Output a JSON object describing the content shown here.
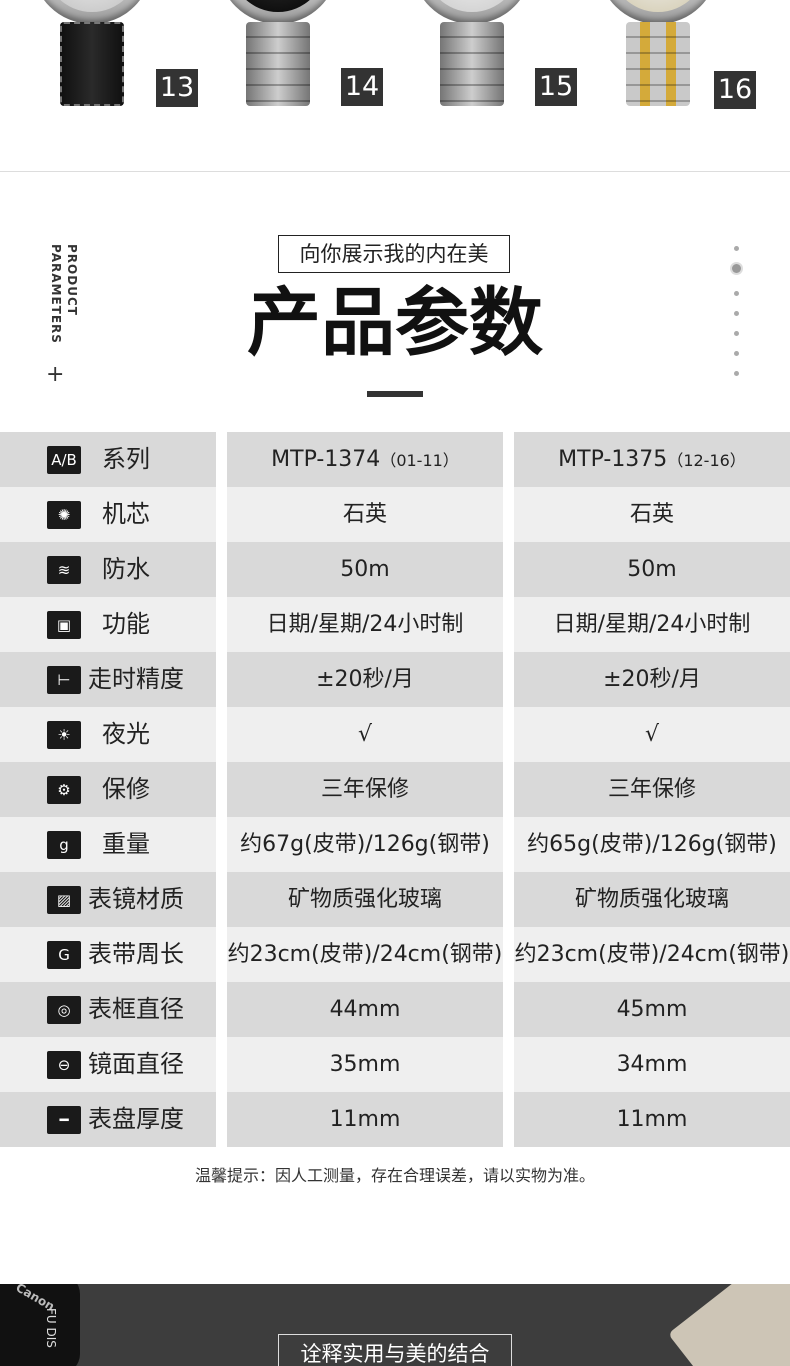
{
  "watches": [
    {
      "number": "13",
      "strap": "leather"
    },
    {
      "number": "14",
      "strap": "steel"
    },
    {
      "number": "15",
      "strap": "steel"
    },
    {
      "number": "16",
      "strap": "two-tone"
    }
  ],
  "header": {
    "side_label_line1": "PRODUCT",
    "side_label_line2": "PARAMETERS",
    "plus": "+",
    "subtitle": "向你展示我的内在美",
    "title": "产品参数"
  },
  "params": [
    {
      "icon": "ab-icon",
      "glyph": "A/B",
      "label": "系列",
      "v1": "MTP-1374",
      "v1_note": "（01-11）",
      "v2": "MTP-1375",
      "v2_note": "（12-16）"
    },
    {
      "icon": "movement-icon",
      "glyph": "✺",
      "label": "机芯",
      "v1": "石英",
      "v2": "石英"
    },
    {
      "icon": "water-icon",
      "glyph": "≋",
      "label": "防水",
      "v1": "50m",
      "v2": "50m"
    },
    {
      "icon": "function-icon",
      "glyph": "▣",
      "label": "功能",
      "v1": "日期/星期/24小时制",
      "v2": "日期/星期/24小时制"
    },
    {
      "icon": "precision-icon",
      "glyph": "⊢",
      "label": "走时精度",
      "v1": "±20秒/月",
      "v2": "±20秒/月"
    },
    {
      "icon": "luminous-icon",
      "glyph": "☀",
      "label": "夜光",
      "v1": "√",
      "v2": "√"
    },
    {
      "icon": "warranty-icon",
      "glyph": "⚙",
      "label": "保修",
      "v1": "三年保修",
      "v2": "三年保修"
    },
    {
      "icon": "weight-icon",
      "glyph": "g",
      "label": "重量",
      "v1": "约67g(皮带)/126g(钢带)",
      "v2": "约65g(皮带)/126g(钢带)"
    },
    {
      "icon": "glass-icon",
      "glyph": "▨",
      "label": "表镜材质",
      "v1": "矿物质强化玻璃",
      "v2": "矿物质强化玻璃"
    },
    {
      "icon": "strap-length-icon",
      "glyph": "G",
      "label": "表带周长",
      "v1": "约23cm(皮带)/24cm(钢带)",
      "v2": "约23cm(皮带)/24cm(钢带)"
    },
    {
      "icon": "case-diameter-icon",
      "glyph": "◎",
      "label": "表框直径",
      "v1": "44mm",
      "v2": "45mm"
    },
    {
      "icon": "glass-diameter-icon",
      "glyph": "⊖",
      "label": "镜面直径",
      "v1": "35mm",
      "v2": "34mm"
    },
    {
      "icon": "thickness-icon",
      "glyph": "━",
      "label": "表盘厚度",
      "v1": "11mm",
      "v2": "11mm"
    }
  ],
  "note": "温馨提示：因人工测量，存在合理误差，请以实物为准。",
  "banner": {
    "brand": "Canon",
    "camera_text": "FU DIS",
    "subtitle": "诠释实用与美的结合"
  },
  "colors": {
    "dark_row": "#d9d9d9",
    "light_row": "#efefef",
    "badge": "#333333",
    "banner": "#3d3d3d"
  }
}
